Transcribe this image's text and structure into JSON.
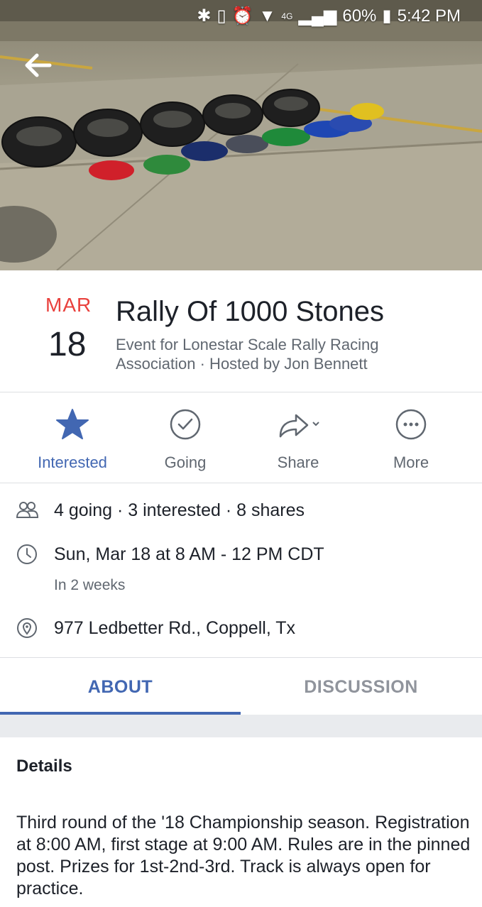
{
  "status_bar": {
    "battery": "60%",
    "time": "5:42 PM",
    "network": "4G"
  },
  "icons": {
    "back": "arrow-left-icon",
    "interested": "star-icon",
    "going": "check-circle-icon",
    "share": "share-arrow-icon",
    "more": "more-dots-icon",
    "people": "people-icon",
    "clock": "clock-icon",
    "location": "location-pin-icon"
  },
  "event": {
    "month": "MAR",
    "day": "18",
    "title": "Rally Of 1000 Stones",
    "subtitle": "Event for Lonestar Scale Rally Racing Association · Hosted by Jon Bennett"
  },
  "actions": [
    {
      "label": "Interested",
      "active": true
    },
    {
      "label": "Going",
      "active": false
    },
    {
      "label": "Share",
      "active": false
    },
    {
      "label": "More",
      "active": false
    }
  ],
  "info": {
    "stats": "4 going · 3 interested · 8 shares",
    "datetime": "Sun, Mar 18 at 8 AM - 12 PM CDT",
    "relative": "In 2 weeks",
    "location": "977 Ledbetter Rd., Coppell, Tx"
  },
  "tabs": [
    {
      "label": "ABOUT",
      "active": true
    },
    {
      "label": "DISCUSSION",
      "active": false
    }
  ],
  "details": {
    "heading": "Details",
    "body": "Third round of the '18 Championship season. Registration at 8:00 AM, first stage at 9:00 AM. Rules are in the pinned post. Prizes for 1st-2nd-3rd. Track is always open for practice."
  },
  "colors": {
    "accent": "#4267b2",
    "month_red": "#e9413d"
  }
}
